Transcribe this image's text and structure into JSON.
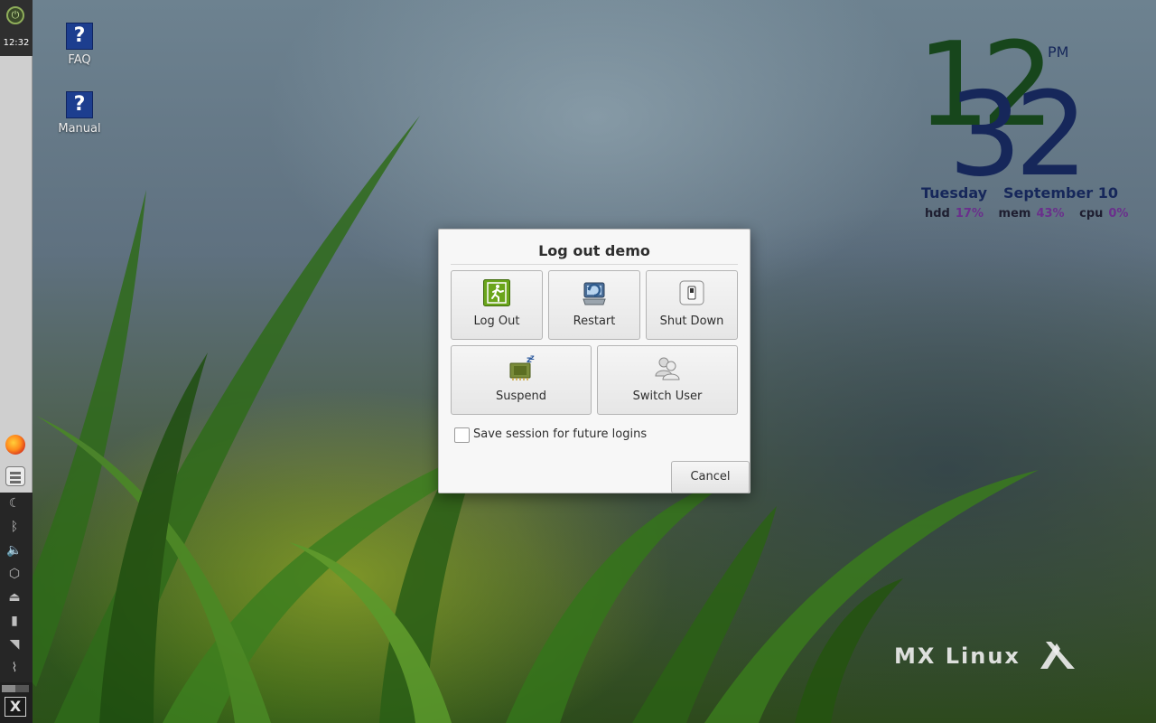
{
  "panel": {
    "clock": "12:32",
    "launchers": [
      {
        "icon": "firefox-icon"
      },
      {
        "icon": "file-manager-icon"
      }
    ],
    "tray": [
      {
        "icon": "moon-icon",
        "glyph": "☾"
      },
      {
        "icon": "bluetooth-icon",
        "glyph": "ᛒ"
      },
      {
        "icon": "volume-icon",
        "glyph": "🔈"
      },
      {
        "icon": "package-icon",
        "glyph": "⬡"
      },
      {
        "icon": "eject-icon",
        "glyph": "⏏"
      },
      {
        "icon": "battery-icon",
        "glyph": "▮"
      },
      {
        "icon": "wifi-icon",
        "glyph": "◥"
      },
      {
        "icon": "clip-icon",
        "glyph": "⌇"
      }
    ]
  },
  "desktop_icons": [
    {
      "label": "FAQ",
      "glyph": "?",
      "icon": "faq-icon"
    },
    {
      "label": "Manual",
      "glyph": "?",
      "icon": "manual-icon"
    }
  ],
  "conky": {
    "hour": "12",
    "minute": "32",
    "ampm": "PM",
    "day": "Tuesday",
    "date": "September 10",
    "stats": [
      {
        "name": "hdd",
        "value": "17%"
      },
      {
        "name": "mem",
        "value": "43%"
      },
      {
        "name": "cpu",
        "value": "0%"
      }
    ]
  },
  "watermark": {
    "text": "MX Linux"
  },
  "dialog": {
    "title": "Log out demo",
    "actions": {
      "logout": "Log Out",
      "restart": "Restart",
      "shutdown": "Shut Down",
      "suspend": "Suspend",
      "switch_user": "Switch User"
    },
    "save_session_label": "Save session for future logins",
    "save_session_checked": false,
    "cancel_label": "Cancel"
  },
  "colors": {
    "hour": "#17461c",
    "minute": "#16275a",
    "stat_value": "#6a2f8c",
    "logout_icon": "#6aa51b"
  }
}
